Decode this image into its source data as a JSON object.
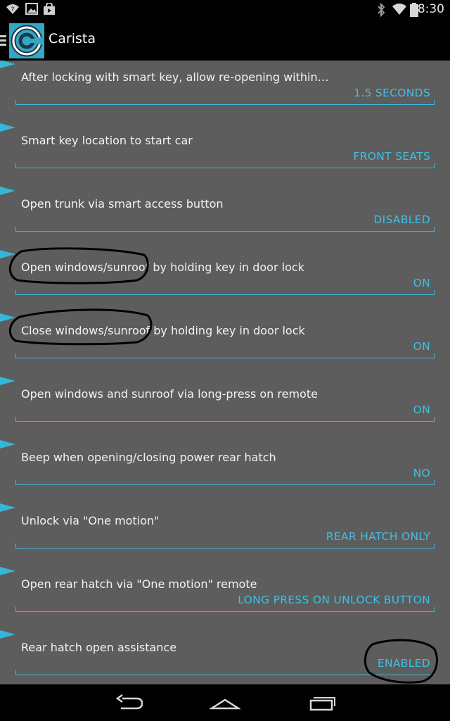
{
  "status_bar": {
    "time": "8:30",
    "left_icons": [
      "wifi-question-icon",
      "image-icon",
      "store-bag-icon"
    ],
    "right_icons": [
      "bluetooth-icon",
      "wifi-icon",
      "battery-icon"
    ]
  },
  "app": {
    "title": "Carista",
    "icon": "carista-logo",
    "accent": "#35b7d9"
  },
  "settings": [
    {
      "label": "After locking with smart key, allow re-opening within…",
      "value": "1.5 SECONDS"
    },
    {
      "label": "Smart key location to start car",
      "value": "FRONT SEATS"
    },
    {
      "label": "Open trunk via smart access button",
      "value": "DISABLED"
    },
    {
      "label": "Open windows/sunroof by holding key in door lock",
      "value": "ON"
    },
    {
      "label": "Close windows/sunroof by holding key in door lock",
      "value": "ON"
    },
    {
      "label": "Open windows and sunroof via long-press on remote",
      "value": "ON"
    },
    {
      "label": "Beep when opening/closing power rear hatch",
      "value": "NO"
    },
    {
      "label": "Unlock via \"One motion\"",
      "value": "REAR HATCH ONLY"
    },
    {
      "label": "Open rear hatch via \"One motion\" remote",
      "value": "LONG PRESS ON UNLOCK BUTTON"
    },
    {
      "label": "Rear hatch open assistance",
      "value": "ENABLED"
    }
  ],
  "nav_bar": {
    "buttons": [
      "back-icon",
      "home-icon",
      "recents-icon"
    ]
  }
}
